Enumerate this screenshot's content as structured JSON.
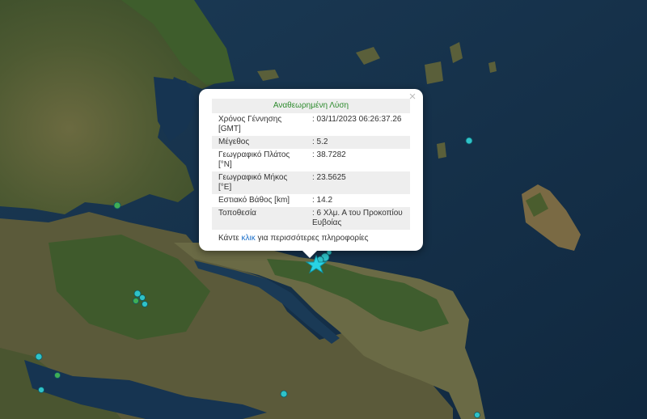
{
  "popup": {
    "title": "Αναθεωρημένη Λύση",
    "close_icon": "×",
    "rows": [
      {
        "label": "Χρόνος Γέννησης [GMT]",
        "value": ": 03/11/2023 06:26:37.26"
      },
      {
        "label": "Μέγεθος",
        "value": ": 5.2"
      },
      {
        "label": "Γεωγραφικό Πλάτος [°N]",
        "value": ": 38.7282"
      },
      {
        "label": "Γεωγραφικό Μήκος [°E]",
        "value": ": 23.5625"
      },
      {
        "label": "Εστιακό Βάθος [km]",
        "value": ": 14.2"
      },
      {
        "label": "Τοποθεσία",
        "value": ": 6 Χλμ. Α του Προκοπίου Ευβοίας"
      }
    ],
    "footer": {
      "prefix": "Κάντε",
      "link_text": "κλικ",
      "suffix": "για περισσότερες πληροφορίες"
    }
  },
  "colors": {
    "sea": "#14304a",
    "land_green": "#3b5a2a",
    "land_brown": "#7a6a4a",
    "quake_cyan": "#2fc2c8",
    "quake_green": "#3fae55",
    "star_cyan": "#29d3e4"
  }
}
